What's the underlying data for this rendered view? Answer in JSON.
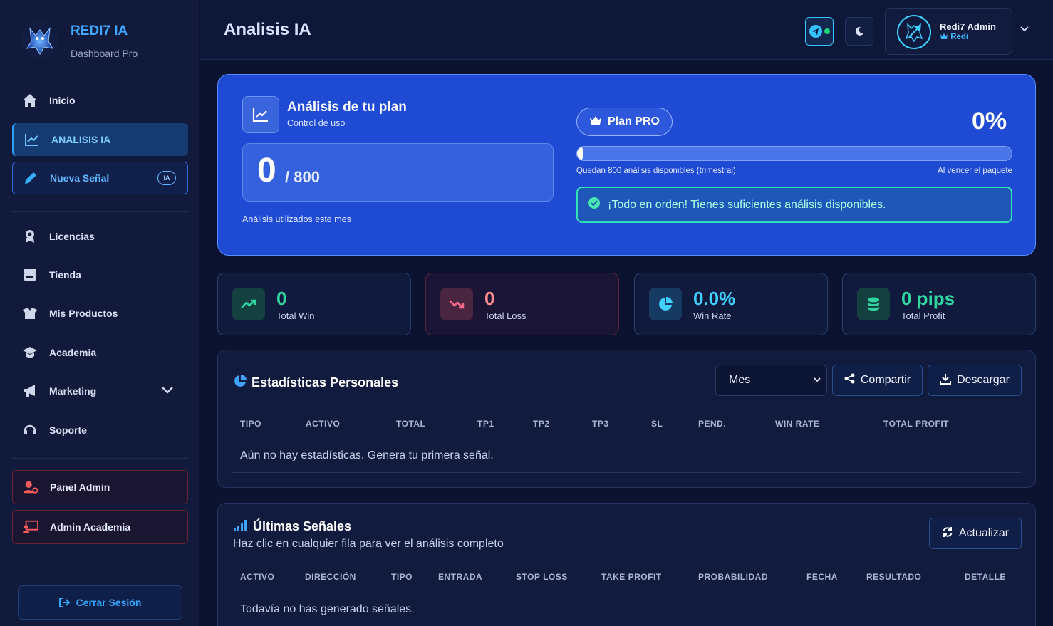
{
  "brand": {
    "title": "REDI7 IA",
    "subtitle": "Dashboard Pro"
  },
  "nav": {
    "inicio": "Inicio",
    "analisis": "ANALISIS IA",
    "nueva_senal": "Nueva Señal",
    "nueva_senal_badge": "IA",
    "licencias": "Licencias",
    "tienda": "Tienda",
    "mis_productos": "Mis Productos",
    "academia": "Academia",
    "marketing": "Marketing",
    "soporte": "Soporte",
    "panel_admin": "Panel Admin",
    "admin_academia": "Admin Academia",
    "logout": "Cerrar Sesión"
  },
  "header": {
    "title": "Analisis IA"
  },
  "user": {
    "name": "Redi7 Admin",
    "role": "Redi"
  },
  "plan": {
    "title": "Análisis de tu plan",
    "subtitle": "Control de uso",
    "used": "0",
    "total": "/ 800",
    "caption": "Análisis utilizados este mes",
    "plan_label": "Plan PRO",
    "percent_label": "0%",
    "percent_value": 0,
    "remaining": "Quedan 800 análisis disponibles (trimestral)",
    "expiry": "Al vencer el paquete",
    "status": "¡Todo en orden! Tienes suficientes análisis disponibles."
  },
  "stats": [
    {
      "value": "0",
      "label": "Total Win",
      "color": "#2fd6a0"
    },
    {
      "value": "0",
      "label": "Total Loss",
      "color": "#ff8a8a"
    },
    {
      "value": "0.0%",
      "label": "Win Rate",
      "color": "#3fd0ff"
    },
    {
      "value": "0 pips",
      "label": "Total Profit",
      "color": "#2fd6a0"
    }
  ],
  "personal": {
    "title": "Estadísticas Personales",
    "period": "Mes",
    "share": "Compartir",
    "download": "Descargar",
    "columns": [
      "TIPO",
      "ACTIVO",
      "TOTAL",
      "TP1",
      "TP2",
      "TP3",
      "SL",
      "PEND.",
      "WIN RATE",
      "TOTAL PROFIT"
    ],
    "empty": "Aún no hay estadísticas. Genera tu primera señal."
  },
  "signals": {
    "title": "Últimas Señales",
    "subtitle": "Haz clic en cualquier fila para ver el análisis completo",
    "refresh": "Actualizar",
    "columns": [
      "ACTIVO",
      "DIRECCIÓN",
      "TIPO",
      "ENTRADA",
      "STOP LOSS",
      "TAKE PROFIT",
      "PROBABILIDAD",
      "FECHA",
      "RESULTADO",
      "DETALLE"
    ],
    "empty": "Todavía no has generado señales."
  }
}
